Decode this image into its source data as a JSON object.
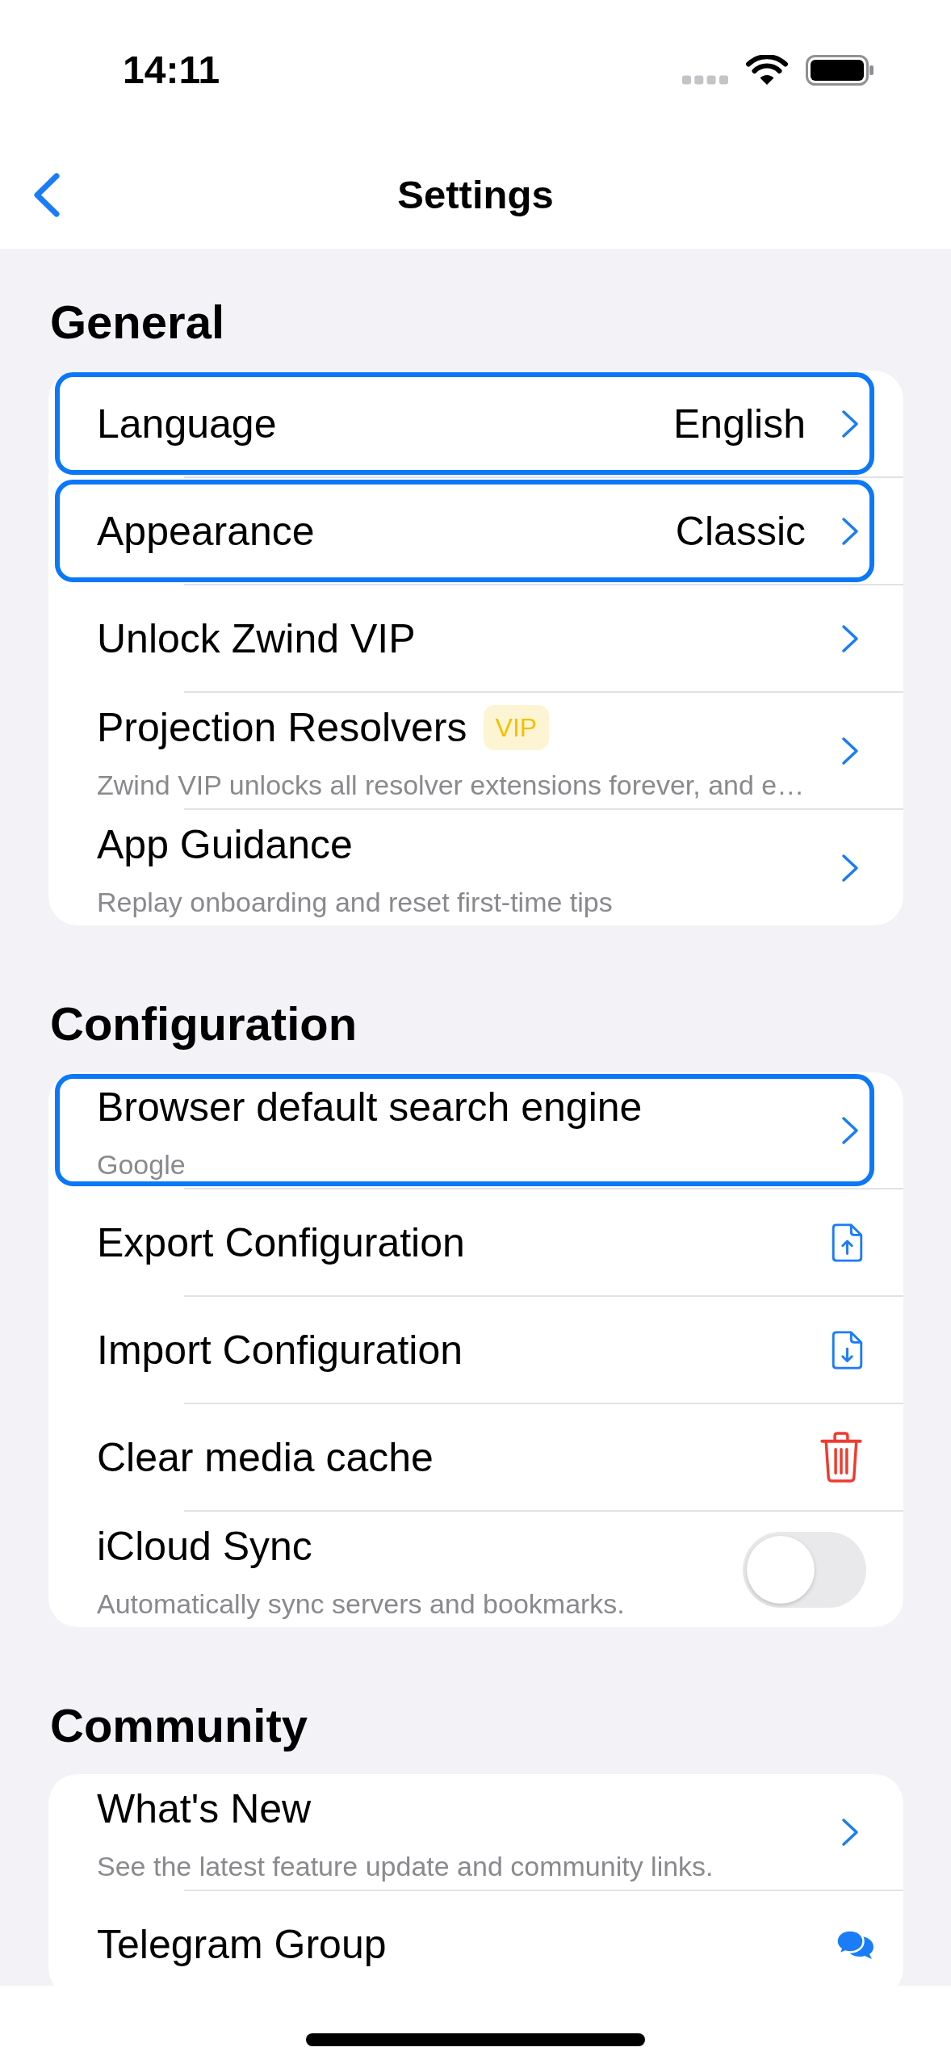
{
  "status_bar": {
    "time": "14:11"
  },
  "nav_bar": {
    "title": "Settings"
  },
  "sections": [
    {
      "title": "General",
      "rows": [
        {
          "kind": "value",
          "title": "Language",
          "value": "English",
          "highlighted": true
        },
        {
          "kind": "value",
          "title": "Appearance",
          "value": "Classic",
          "highlighted": true
        },
        {
          "kind": "link",
          "title": "Unlock Zwind VIP",
          "highlighted": false
        },
        {
          "kind": "link",
          "title": "Projection Resolvers",
          "badge": "VIP",
          "subtitle": "Zwind VIP unlocks all resolver extensions forever, and e…",
          "highlighted": false
        },
        {
          "kind": "link",
          "title": "App Guidance",
          "subtitle": "Replay onboarding and reset first-time tips",
          "highlighted": false
        }
      ]
    },
    {
      "title": "Configuration",
      "rows": [
        {
          "kind": "link",
          "title": "Browser default search engine",
          "subtitle": "Google",
          "highlighted": true
        },
        {
          "kind": "export",
          "title": "Export Configuration",
          "highlighted": false
        },
        {
          "kind": "import",
          "title": "Import Configuration",
          "highlighted": false
        },
        {
          "kind": "delete",
          "title": "Clear media cache",
          "highlighted": false
        },
        {
          "kind": "toggle",
          "title": "iCloud Sync",
          "subtitle": "Automatically sync servers and bookmarks.",
          "on": false,
          "highlighted": false
        }
      ]
    },
    {
      "title": "Community",
      "rows": [
        {
          "kind": "link",
          "title": "What's New",
          "subtitle": "See the latest feature update and community links.",
          "highlighted": false
        },
        {
          "kind": "chat",
          "title": "Telegram Group",
          "highlighted": false
        }
      ]
    }
  ]
}
